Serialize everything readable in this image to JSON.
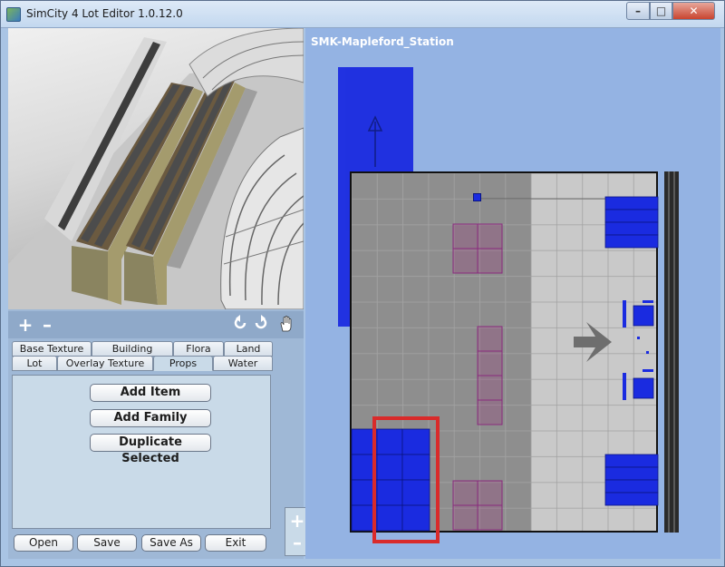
{
  "window": {
    "title": "SimCity 4 Lot Editor 1.0.12.0",
    "controls": {
      "minimize": "–",
      "maximize": "□",
      "close": "✕"
    }
  },
  "toolbar": {
    "zoom_in": "+",
    "zoom_out": "–",
    "icons": [
      "rotate-left-icon",
      "rotate-right-icon",
      "hand-pan-icon"
    ]
  },
  "tabs": {
    "row1": [
      "Base Texture",
      "Building",
      "Flora",
      "Land"
    ],
    "row2": [
      "Lot",
      "Overlay Texture",
      "Props",
      "Water"
    ],
    "active": "Props"
  },
  "props_panel": {
    "add_item": "Add Item",
    "add_family": "Add Family",
    "duplicate_selected": "Duplicate Selected"
  },
  "side_zoom": {
    "zoom_in": "+",
    "zoom_out": "–"
  },
  "file_buttons": {
    "open": "Open",
    "save": "Save",
    "save_as": "Save As",
    "exit": "Exit"
  },
  "lot": {
    "name": "SMK-Mapleford_Station"
  },
  "colors": {
    "window_frame": "#a9c4e4",
    "lot_background": "#94b3e3",
    "prop_blue": "#1a2be0",
    "selection_red": "#d92b2b",
    "tile_gray": "#8e8e8e",
    "tile_light": "#c9c9c9"
  }
}
